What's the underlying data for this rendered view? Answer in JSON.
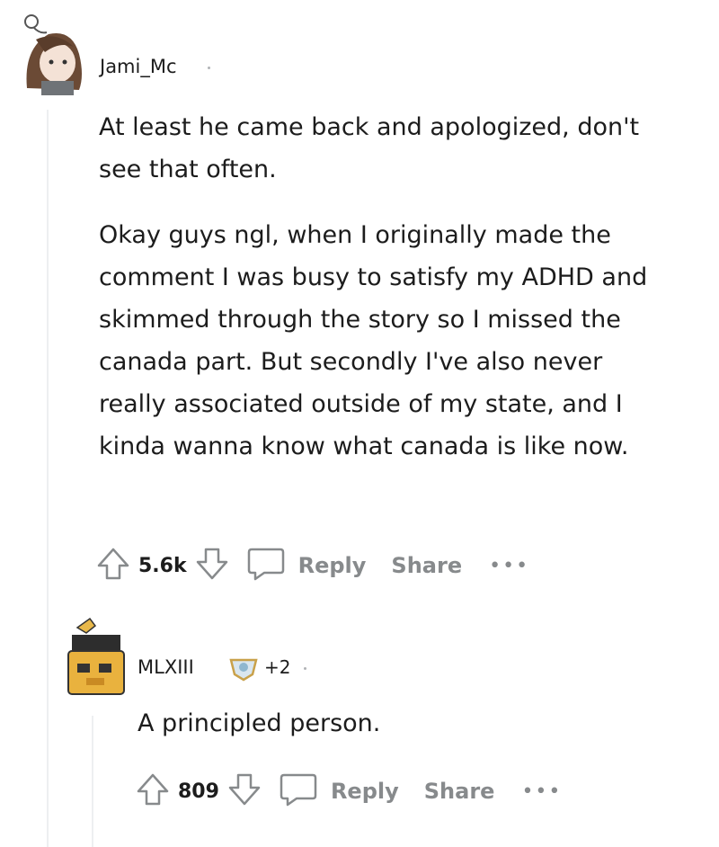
{
  "comment1": {
    "username": "Jami_Mc",
    "paragraphs": [
      "At least he came back and apologized, don't see that often.",
      "Okay guys ngl, when I originally made the comment I was busy to satisfy my ADHD and skimmed through the story so I missed the canada part. But secondly I've also never really associated outside of my state, and I kinda wanna know what canada is like now."
    ],
    "votes": "5.6k",
    "reply_label": "Reply",
    "share_label": "Share",
    "more_label": "•••"
  },
  "comment2": {
    "username": "MLXIII",
    "award_count": "+2",
    "text": "A principled person.",
    "votes": "809",
    "reply_label": "Reply",
    "share_label": "Share",
    "more_label": "•••"
  },
  "colors": {
    "text": "#1c1c1c",
    "muted": "#878a8c",
    "thread_line": "#edeff1"
  }
}
